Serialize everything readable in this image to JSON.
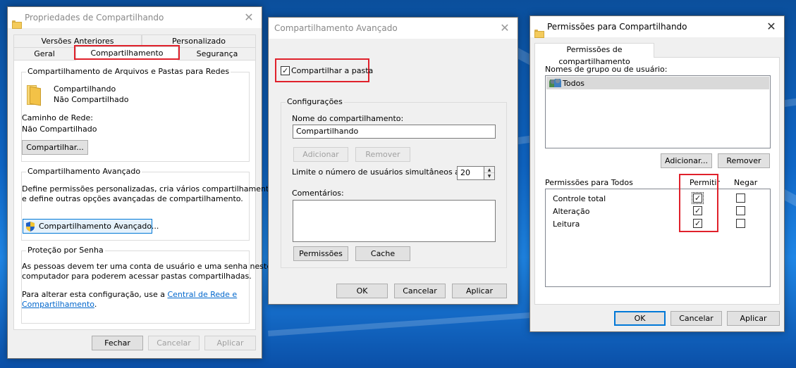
{
  "win1": {
    "title": "Propriedades de Compartilhando",
    "tabs_row1": [
      "Versões Anteriores",
      "Personalizado"
    ],
    "tabs_row2": [
      "Geral",
      "Compartilhamento",
      "Segurança"
    ],
    "group1_label": "Compartilhamento de Arquivos e Pastas para Redes",
    "folder_name": "Compartilhando",
    "folder_status": "Não Compartilhado",
    "network_path_label": "Caminho de Rede:",
    "network_path_value": "Não Compartilhado",
    "share_button": "Compartilhar...",
    "group2_label": "Compartilhamento Avançado",
    "group2_text1": "Define permissões personalizadas, cria vários compartilhamentos",
    "group2_text2": "e define outras opções avançadas de compartilhamento.",
    "advanced_button": "Compartilhamento Avançado...",
    "group3_label": "Proteção por Senha",
    "group3_text1": "As pessoas devem ter uma conta de usuário e uma senha neste",
    "group3_text2": "computador para poderem acessar pastas compartilhadas.",
    "group3_text3": "Para alterar esta configuração, use a ",
    "group3_link1": "Central de Rede e",
    "group3_link2": "Compartilhamento",
    "group3_text4": ".",
    "btn_close": "Fechar",
    "btn_cancel": "Cancelar",
    "btn_apply": "Aplicar"
  },
  "win2": {
    "title": "Compartilhamento Avançado",
    "share_checkbox_label": "Compartilhar a pasta",
    "share_checked": true,
    "settings_label": "Configurações",
    "share_name_label": "Nome do compartilhamento:",
    "share_name_value": "Compartilhando",
    "btn_add": "Adicionar",
    "btn_remove": "Remover",
    "limit_label": "Limite o número de usuários simultâneos a:",
    "limit_value": "20",
    "comments_label": "Comentários:",
    "btn_permissions": "Permissões",
    "btn_cache": "Cache",
    "btn_ok": "OK",
    "btn_cancel": "Cancelar",
    "btn_apply": "Aplicar"
  },
  "win3": {
    "title": "Permissões para Compartilhando",
    "tab": "Permissões de compartilhamento",
    "group_users_label": "Nomes de grupo ou de usuário:",
    "users": [
      "Todos"
    ],
    "btn_add": "Adicionar...",
    "btn_remove": "Remover",
    "perms_label": "Permissões para Todos",
    "col_allow": "Permitir",
    "col_deny": "Negar",
    "permissions": [
      {
        "name": "Controle total",
        "allow": true,
        "deny": false
      },
      {
        "name": "Alteração",
        "allow": true,
        "deny": false
      },
      {
        "name": "Leitura",
        "allow": true,
        "deny": false
      }
    ],
    "btn_ok": "OK",
    "btn_cancel": "Cancelar",
    "btn_apply": "Aplicar"
  },
  "colors": {
    "highlight_red": "#e0212b",
    "link_blue": "#0066cc",
    "focus_blue": "#0078d7",
    "desktop_blue": "#0f66c6"
  }
}
